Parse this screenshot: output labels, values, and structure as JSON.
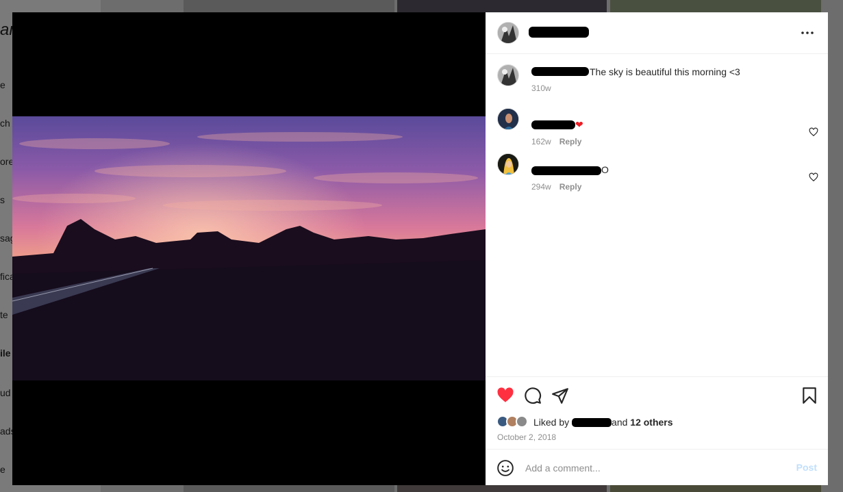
{
  "background": {
    "nav_fragments": [
      "e",
      "ch",
      "ore",
      "s",
      "sag",
      "fica",
      "te",
      "ile",
      "ud",
      "ads",
      "e"
    ],
    "logo_fragment": "an"
  },
  "post": {
    "author_name": "",
    "menu_icon": "more-horizontal-icon",
    "caption": {
      "text": "The sky is beautiful this morning <3",
      "age": "310w"
    },
    "comments": [
      {
        "text": "",
        "emoji": "❤",
        "age": "162w",
        "reply_label": "Reply",
        "like_icon": "heart-outline-icon"
      },
      {
        "text": "O",
        "age": "294w",
        "reply_label": "Reply",
        "like_icon": "heart-outline-icon"
      }
    ],
    "actions": {
      "like_icon": "heart-filled-icon",
      "comment_icon": "comment-icon",
      "share_icon": "send-icon",
      "save_icon": "bookmark-icon"
    },
    "likes": {
      "prefix": "Liked by",
      "connector": "and",
      "others": "12 others"
    },
    "date": "October 2, 2018",
    "add_comment": {
      "placeholder": "Add a comment...",
      "post_label": "Post",
      "emoji_icon": "smiley-icon"
    },
    "colors": {
      "like_red": "#ff3040",
      "post_blue_disabled": "#c0dffd",
      "meta_gray": "#8e8e8e"
    }
  }
}
